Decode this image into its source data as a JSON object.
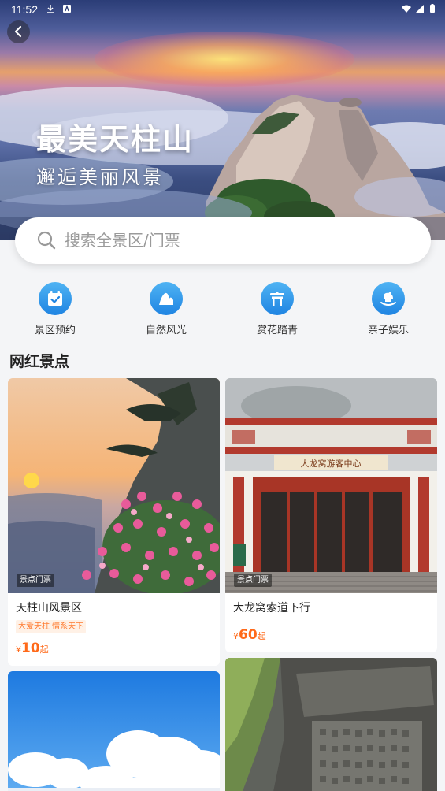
{
  "status_bar": {
    "time": "11:52"
  },
  "hero": {
    "title": "最美天柱山",
    "subtitle": "邂逅美丽风景"
  },
  "search": {
    "placeholder": "搜索全景区/门票"
  },
  "categories": [
    {
      "label": "景区预约",
      "icon": "calendar-check-icon"
    },
    {
      "label": "自然风光",
      "icon": "mountain-icon"
    },
    {
      "label": "赏花踏青",
      "icon": "pavilion-icon"
    },
    {
      "label": "亲子娱乐",
      "icon": "rocking-horse-icon"
    }
  ],
  "section_title": "网红景点",
  "cards": [
    {
      "tag": "景点门票",
      "name": "天柱山风景区",
      "badge": "大爱天柱 情系天下",
      "currency": "¥",
      "price": "10",
      "unit": "起"
    },
    {
      "tag": "景点门票",
      "name": "大龙窝索道下行",
      "currency": "¥",
      "price": "60",
      "unit": "起"
    }
  ],
  "building_sign": "大龙窝游客中心",
  "colors": {
    "accent": "#1f84e2",
    "price": "#ff6a1a",
    "badge_bg": "#fff1e6"
  }
}
